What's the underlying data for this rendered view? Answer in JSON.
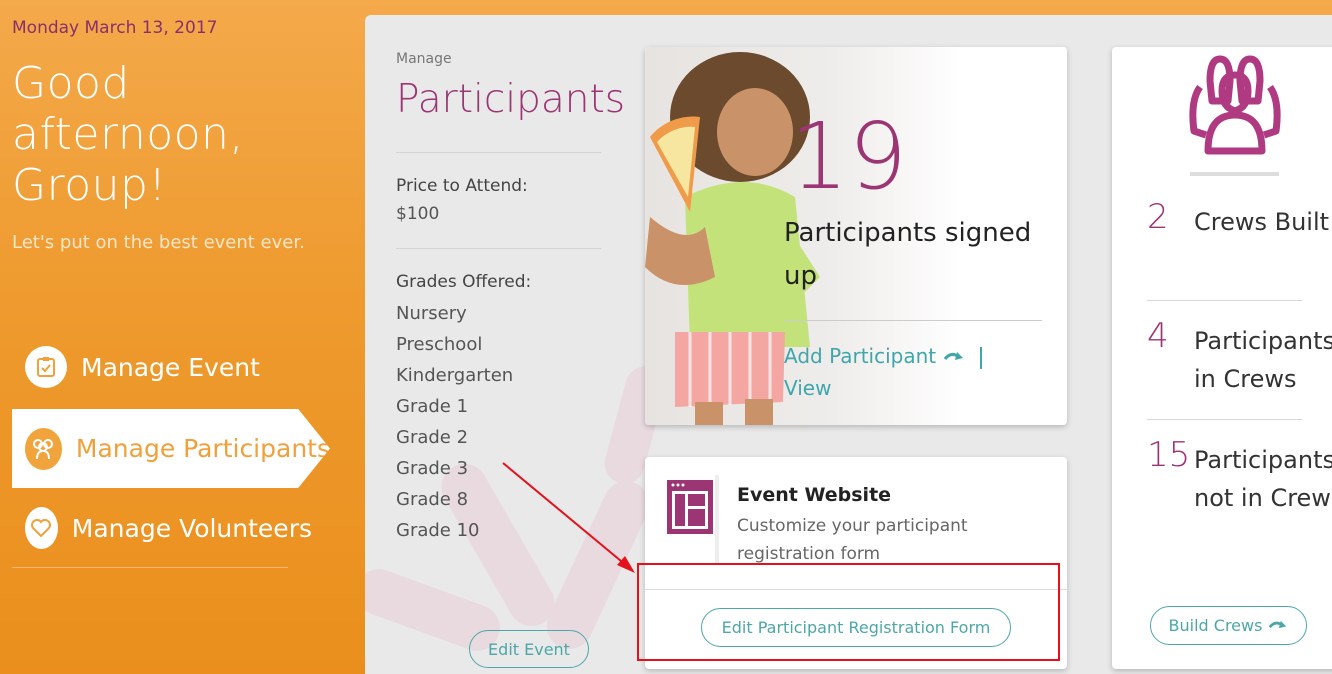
{
  "sidebar": {
    "date": "Monday March 13, 2017",
    "greeting": "Good afternoon, Group!",
    "tagline": "Let's put on the best event ever.",
    "nav": [
      {
        "label": "Manage Event",
        "icon": "checklist-icon",
        "active": false
      },
      {
        "label": "Manage Participants",
        "icon": "people-icon",
        "active": true
      },
      {
        "label": "Manage Volunteers",
        "icon": "heart-icon",
        "active": false
      }
    ]
  },
  "manage": {
    "label": "Manage",
    "title": "Participants",
    "price_label": "Price to Attend:",
    "price_value": "$100",
    "grades_label": "Grades Offered:",
    "grades": [
      "Nursery",
      "Preschool",
      "Kindergarten",
      "Grade 1",
      "Grade 2",
      "Grade 3",
      "Grade 8",
      "Grade 10"
    ],
    "edit_event_label": "Edit Event"
  },
  "participants_card": {
    "count": "19",
    "caption": "Participants signed up",
    "add_label": "Add Participant",
    "view_label": "View"
  },
  "website_card": {
    "title": "Event Website",
    "description": "Customize your participant registration form",
    "button_label": "Edit Participant Registration Form"
  },
  "crews_card": {
    "stats": [
      {
        "value": "2",
        "label": "Crews Built"
      },
      {
        "value": "4",
        "label": "Participants in Crews"
      },
      {
        "value": "15",
        "label": "Participants not in Crews"
      }
    ],
    "button_label": "Build Crews"
  },
  "colors": {
    "brand_purple": "#9c3573",
    "accent_teal": "#4da7a8",
    "sidebar_orange": "#ee9a2e",
    "annotation_red": "#e4121b"
  }
}
